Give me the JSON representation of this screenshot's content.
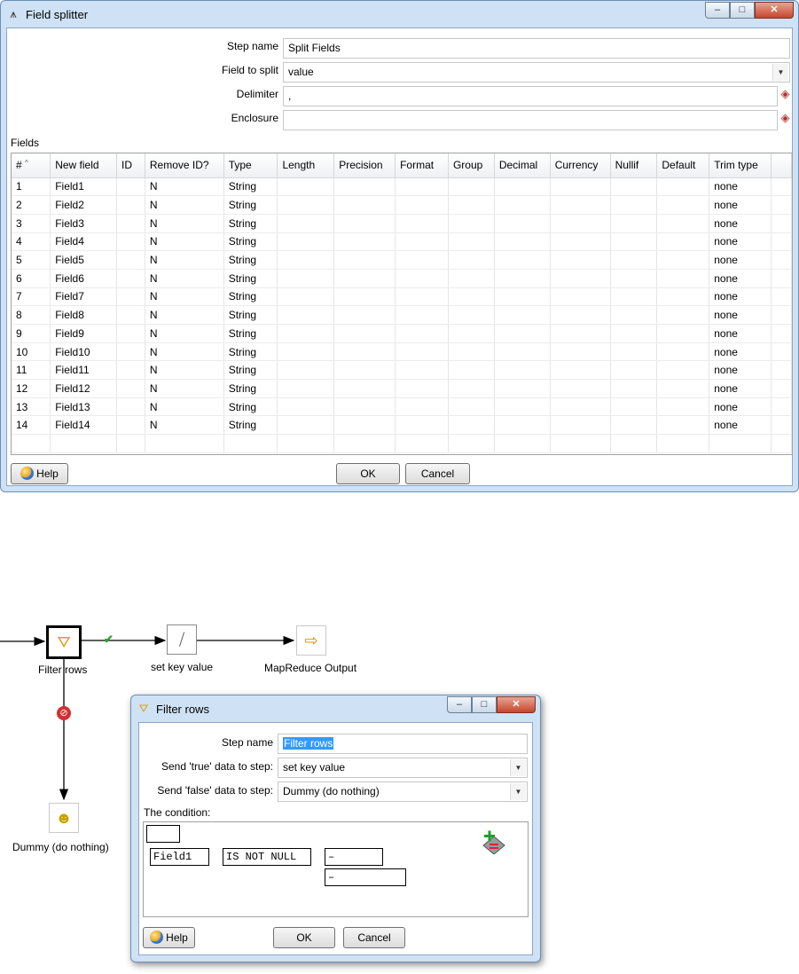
{
  "field_splitter": {
    "window_title": "Field splitter",
    "controls": {
      "minimize": "–",
      "maximize": "□",
      "close": "✕"
    },
    "step_name": {
      "label": "Step name",
      "value": "Split Fields"
    },
    "field_to_split": {
      "label": "Field to split",
      "value": "value"
    },
    "delimiter": {
      "label": "Delimiter",
      "value": ","
    },
    "enclosure": {
      "label": "Enclosure",
      "value": ""
    },
    "fields_label": "Fields",
    "columns": [
      "#",
      "New field",
      "ID",
      "Remove ID?",
      "Type",
      "Length",
      "Precision",
      "Format",
      "Group",
      "Decimal",
      "Currency",
      "Nullif",
      "Default",
      "Trim type"
    ],
    "rows": [
      [
        "1",
        "Field1",
        "",
        "N",
        "String",
        "",
        "",
        "",
        "",
        "",
        "",
        "",
        "",
        "none"
      ],
      [
        "2",
        "Field2",
        "",
        "N",
        "String",
        "",
        "",
        "",
        "",
        "",
        "",
        "",
        "",
        "none"
      ],
      [
        "3",
        "Field3",
        "",
        "N",
        "String",
        "",
        "",
        "",
        "",
        "",
        "",
        "",
        "",
        "none"
      ],
      [
        "4",
        "Field4",
        "",
        "N",
        "String",
        "",
        "",
        "",
        "",
        "",
        "",
        "",
        "",
        "none"
      ],
      [
        "5",
        "Field5",
        "",
        "N",
        "String",
        "",
        "",
        "",
        "",
        "",
        "",
        "",
        "",
        "none"
      ],
      [
        "6",
        "Field6",
        "",
        "N",
        "String",
        "",
        "",
        "",
        "",
        "",
        "",
        "",
        "",
        "none"
      ],
      [
        "7",
        "Field7",
        "",
        "N",
        "String",
        "",
        "",
        "",
        "",
        "",
        "",
        "",
        "",
        "none"
      ],
      [
        "8",
        "Field8",
        "",
        "N",
        "String",
        "",
        "",
        "",
        "",
        "",
        "",
        "",
        "",
        "none"
      ],
      [
        "9",
        "Field9",
        "",
        "N",
        "String",
        "",
        "",
        "",
        "",
        "",
        "",
        "",
        "",
        "none"
      ],
      [
        "10",
        "Field10",
        "",
        "N",
        "String",
        "",
        "",
        "",
        "",
        "",
        "",
        "",
        "",
        "none"
      ],
      [
        "11",
        "Field11",
        "",
        "N",
        "String",
        "",
        "",
        "",
        "",
        "",
        "",
        "",
        "",
        "none"
      ],
      [
        "12",
        "Field12",
        "",
        "N",
        "String",
        "",
        "",
        "",
        "",
        "",
        "",
        "",
        "",
        "none"
      ],
      [
        "13",
        "Field13",
        "",
        "N",
        "String",
        "",
        "",
        "",
        "",
        "",
        "",
        "",
        "",
        "none"
      ],
      [
        "14",
        "Field14",
        "",
        "N",
        "String",
        "",
        "",
        "",
        "",
        "",
        "",
        "",
        "",
        "none"
      ]
    ],
    "help_button": "Help",
    "ok_button": "OK",
    "cancel_button": "Cancel"
  },
  "canvas": {
    "steps": {
      "filter_rows": "Filter rows",
      "set_key_value": "set key value",
      "mapreduce_output": "MapReduce Output",
      "dummy": "Dummy (do nothing)"
    },
    "hop_true_icon": "✔",
    "hop_false_icon": "⊘"
  },
  "filter_rows": {
    "window_title": "Filter rows",
    "controls": {
      "minimize": "–",
      "maximize": "□",
      "close": "✕"
    },
    "step_name": {
      "label": "Step name",
      "value": "Filter rows"
    },
    "send_true": {
      "label": "Send 'true' data to step:",
      "value": "set key value"
    },
    "send_false": {
      "label": "Send 'false' data to step:",
      "value": "Dummy (do nothing)"
    },
    "condition_label": "The condition:",
    "condition": {
      "field": "Field1",
      "function": "IS NOT NULL",
      "value_a": "–",
      "value_b": "–"
    },
    "help_button": "Help",
    "ok_button": "OK",
    "cancel_button": "Cancel"
  },
  "colors": {
    "window_frame": "#cfe2f5",
    "close_button": "#c7452d",
    "selection": "#3399ff",
    "hop_true": "#2e9d2e",
    "hop_false": "#d32f2f"
  }
}
